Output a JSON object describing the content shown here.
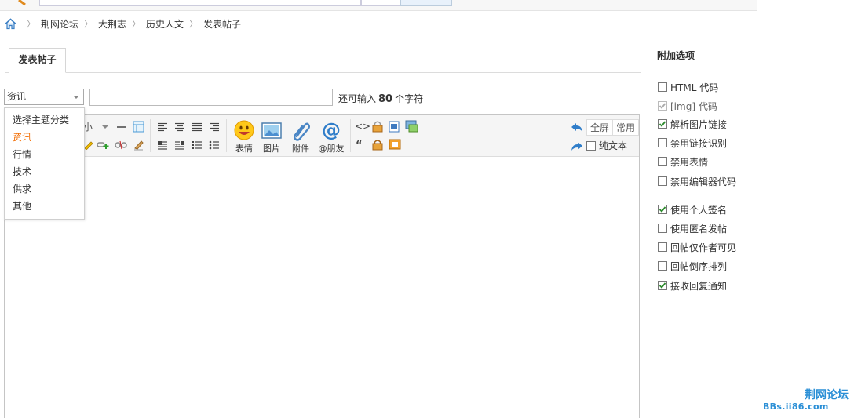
{
  "breadcrumb": [
    "荆网论坛",
    "大荆志",
    "历史人文",
    "发表帖子"
  ],
  "tab": {
    "label": "发表帖子"
  },
  "subject": {
    "category_selected": "资讯",
    "value": "",
    "count_prefix": "还可输入",
    "count_value": "80",
    "count_suffix": "个字符"
  },
  "category_options": [
    "选择主题分类",
    "资讯",
    "行情",
    "技术",
    "供求",
    "其他"
  ],
  "toolbar": {
    "size_label": "小",
    "emoji_label": "表情",
    "image_label": "图片",
    "attach_label": "附件",
    "mention_label": "@朋友",
    "fullscreen_label": "全屏",
    "common_label": "常用",
    "plaintext_label": "纯文本"
  },
  "sidebar": {
    "title": "附加选项",
    "options": [
      {
        "label": "HTML 代码",
        "checked": false,
        "disabled": false
      },
      {
        "label": "[img] 代码",
        "checked": true,
        "disabled": true
      },
      {
        "label": "解析图片链接",
        "checked": true,
        "disabled": false
      },
      {
        "label": "禁用链接识别",
        "checked": false,
        "disabled": false
      },
      {
        "label": "禁用表情",
        "checked": false,
        "disabled": false
      },
      {
        "label": "禁用编辑器代码",
        "checked": false,
        "disabled": false
      },
      {
        "label": "使用个人签名",
        "checked": true,
        "disabled": false
      },
      {
        "label": "使用匿名发帖",
        "checked": false,
        "disabled": false
      },
      {
        "label": "回帖仅作者可见",
        "checked": false,
        "disabled": false
      },
      {
        "label": "回帖倒序排列",
        "checked": false,
        "disabled": false
      },
      {
        "label": "接收回复通知",
        "checked": true,
        "disabled": false
      }
    ]
  },
  "watermark": {
    "title": "荆网论坛",
    "url": "BBs.ii86.com"
  },
  "colors": {
    "accent": "#2b8fd6",
    "selected_option": "#f26c00",
    "check": "#2e8b2e"
  }
}
